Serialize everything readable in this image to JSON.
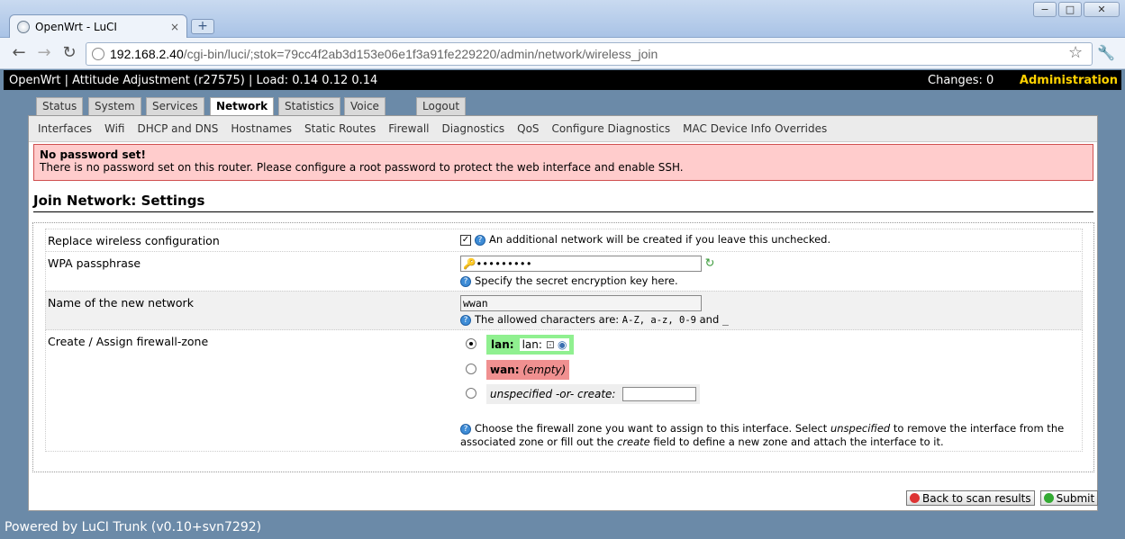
{
  "browser": {
    "tab_title": "OpenWrt - LuCI",
    "tab_close": "×",
    "new_tab": "+",
    "window_controls": [
      "−",
      "□",
      "✕"
    ],
    "url_host": "192.168.2.40",
    "url_path": "/cgi-bin/luci/;stok=79cc4f2ab3d153e06e1f3a91fe229220/admin/network/wireless_join"
  },
  "header": {
    "title": "OpenWrt | Attitude Adjustment (r27575) | Load: 0.14 0.12 0.14",
    "changes": "Changes: 0",
    "admin": "Administration"
  },
  "menu": {
    "tabs": [
      "Status",
      "System",
      "Services",
      "Network",
      "Statistics",
      "Voice",
      "Logout"
    ],
    "active": "Network"
  },
  "submenu": [
    "Interfaces",
    "Wifi",
    "DHCP and DNS",
    "Hostnames",
    "Static Routes",
    "Firewall",
    "Diagnostics",
    "QoS",
    "Configure Diagnostics",
    "MAC Device Info Overrides"
  ],
  "alert": {
    "title": "No password set!",
    "text": "There is no password set on this router. Please configure a root password to protect the web interface and enable SSH."
  },
  "section_title": "Join Network: Settings",
  "form": {
    "replace": {
      "label": "Replace wireless configuration",
      "checked": true,
      "help": "An additional network will be created if you leave this unchecked."
    },
    "wpa": {
      "label": "WPA passphrase",
      "value": "•••••••••",
      "help": "Specify the secret encryption key here."
    },
    "network_name": {
      "label": "Name of the new network",
      "value": "wwan",
      "help_prefix": "The allowed characters are: ",
      "help_chars": "A-Z, a-z, 0-9",
      "help_and": " and ",
      "help_underscore": "_"
    },
    "firewall": {
      "label": "Create / Assign firewall-zone",
      "lan_label": "lan:",
      "lan_value": "lan:",
      "wan_label": "wan:",
      "wan_value": "(empty)",
      "unspecified": "unspecified -or- create:",
      "help_1": "Choose the firewall zone you want to assign to this interface. Select ",
      "help_unspecified": "unspecified",
      "help_2": " to remove the interface from the associated zone or fill out the ",
      "help_create": "create",
      "help_3": " field to define a new zone and attach the interface to it.",
      "selected": "lan"
    }
  },
  "buttons": {
    "back": "Back to scan results",
    "submit": "Submit"
  },
  "footer": "Powered by LuCI Trunk (v0.10+svn7292)"
}
